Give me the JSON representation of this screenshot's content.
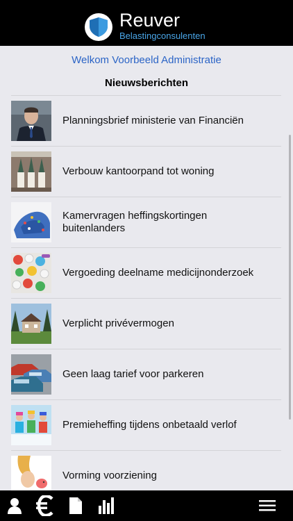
{
  "header": {
    "brand_name": "Reuver",
    "brand_subtitle": "Belastingconsulenten",
    "logo_icon": "shield-icon"
  },
  "main": {
    "welcome": "Welkom Voorbeeld Administratie",
    "section_title": "Nieuwsberichten"
  },
  "news": {
    "items": [
      {
        "title": "Planningsbrief ministerie van Financiën",
        "thumb": "minister-portrait-photo"
      },
      {
        "title": "Verbouw kantoorpand tot woning",
        "thumb": "building-photo"
      },
      {
        "title": "Kamervragen heffingskortingen buitenlanders",
        "thumb": "europe-map-photo"
      },
      {
        "title": "Vergoeding deelname medicijnonderzoek",
        "thumb": "pills-photo"
      },
      {
        "title": "Verplicht privévermogen",
        "thumb": "house-photo"
      },
      {
        "title": "Geen laag tarief voor parkeren",
        "thumb": "parked-cars-photo"
      },
      {
        "title": "Premieheffing tijdens onbetaald verlof",
        "thumb": "skiers-photo"
      },
      {
        "title": "Vorming voorziening",
        "thumb": "piggy-bank-photo"
      }
    ]
  },
  "tabbar": {
    "tabs": [
      {
        "icon": "user-icon"
      },
      {
        "icon": "euro-icon"
      },
      {
        "icon": "document-icon"
      },
      {
        "icon": "bar-chart-icon"
      },
      {
        "icon": "menu-icon"
      }
    ]
  },
  "colors": {
    "header_bg": "#000000",
    "accent": "#2b64c6",
    "brand_subtitle": "#4aa6e8",
    "background": "#e9e9ee"
  }
}
